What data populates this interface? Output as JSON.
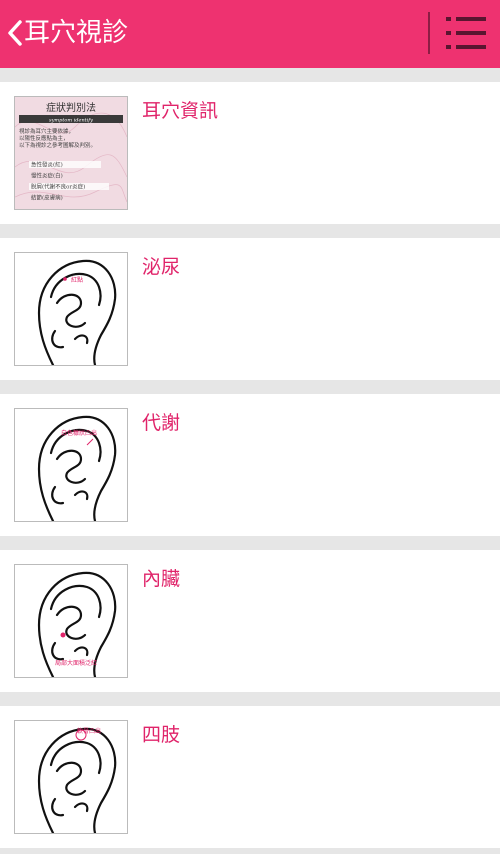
{
  "header": {
    "title": "耳穴視診",
    "back_icon": "chevron-left-icon",
    "menu_icon": "list-menu-icon",
    "bg_color": "#ee3270"
  },
  "items": [
    {
      "label": "耳穴資訊",
      "thumb_title": "症狀判別法",
      "thumb_subtitle": "symptom identify",
      "thumb_text": [
        "視診為耳穴主要依據，",
        "以陽性反應點為主，",
        "以下為視診之參考圖解及判別。"
      ],
      "thumb_list": [
        "急性發炎(紅)",
        "慢性炎症(白)",
        "脫屑(代謝不良or炎症)",
        "結節(皮膚病)"
      ]
    },
    {
      "label": "泌尿",
      "thumb_annotation": "紅點"
    },
    {
      "label": "代謝",
      "thumb_annotation": "白色糠狀凸出"
    },
    {
      "label": "內臟",
      "thumb_annotation": "局部大面積泛紅"
    },
    {
      "label": "四肢",
      "thumb_annotation": "軟骨凸出"
    }
  ],
  "accent_color": "#e0246a"
}
